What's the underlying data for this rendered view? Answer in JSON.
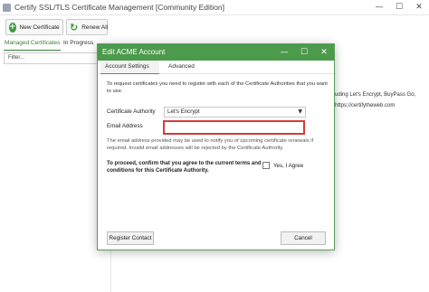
{
  "app": {
    "title": "Certify SSL/TLS Certificate Management [Community Edition]"
  },
  "window_controls": {
    "minimize": "—",
    "maximize": "☐",
    "close": "✕"
  },
  "toolbar": {
    "new_certificate_label": "New Certificate",
    "renew_all_label": "Renew All",
    "new_icon_glyph": "+",
    "renew_icon_glyph": "↻",
    "icon_color": "#3c9a3c"
  },
  "tabs": {
    "managed_label": "Managed Certificates",
    "in_progress_label": "In Progress"
  },
  "filter": {
    "placeholder": "Filter..."
  },
  "background": {
    "partial_text_1": "uding Let's Encrypt, BuyPass Go,",
    "partial_text_2": "https://certifytheweb.com"
  },
  "dialog": {
    "title": "Edit ACME Account",
    "controls": {
      "minimize": "—",
      "maximize": "☐",
      "close": "✕"
    },
    "tabs": {
      "account_settings": "Account Settings",
      "advanced": "Advanced"
    },
    "intro": "To request certificates you need to register with each of the Certificate Authorities that you want to use.",
    "ca_label": "Certificate Authority",
    "ca_value": "Let's Encrypt",
    "ca_caret": "▼",
    "email_label": "Email Address",
    "email_value": "",
    "email_note": "The email address provided may be used to notify you of upcoming certificate renewals if required. Invalid email addresses will be rejected by the Certificate Authority.",
    "agree_text": "To proceed, confirm that you agree to the current terms and conditions for this Certificate Authority.",
    "agree_label": "Yes, I Agree",
    "agree_checked": false,
    "register_button": "Register Contact",
    "cancel_button": "Cancel",
    "accent_color": "#4c9a4c",
    "error_outline_color": "#d33b3b"
  }
}
